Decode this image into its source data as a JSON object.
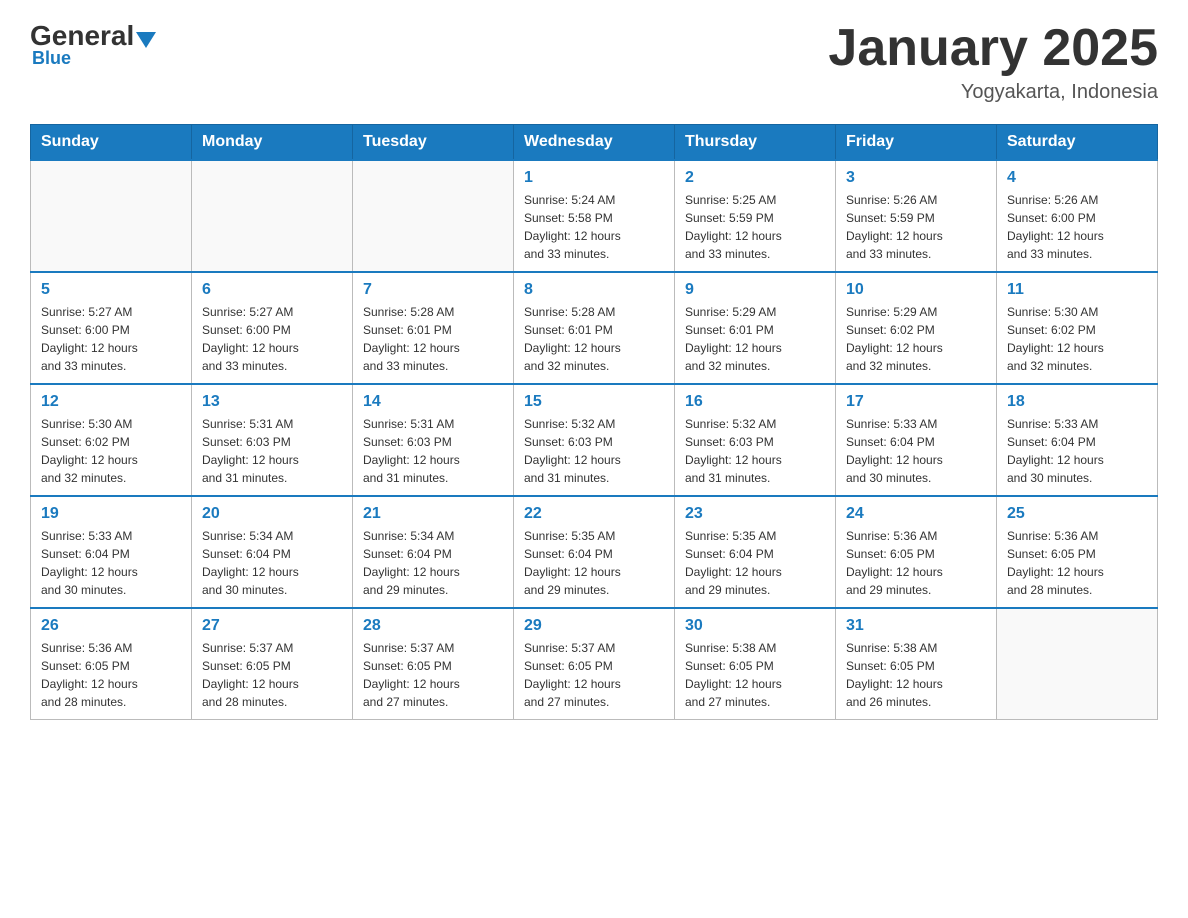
{
  "header": {
    "logo_general": "General",
    "logo_blue": "Blue",
    "calendar_title": "January 2025",
    "calendar_subtitle": "Yogyakarta, Indonesia"
  },
  "weekdays": [
    "Sunday",
    "Monday",
    "Tuesday",
    "Wednesday",
    "Thursday",
    "Friday",
    "Saturday"
  ],
  "weeks": [
    [
      {
        "day": "",
        "info": ""
      },
      {
        "day": "",
        "info": ""
      },
      {
        "day": "",
        "info": ""
      },
      {
        "day": "1",
        "info": "Sunrise: 5:24 AM\nSunset: 5:58 PM\nDaylight: 12 hours\nand 33 minutes."
      },
      {
        "day": "2",
        "info": "Sunrise: 5:25 AM\nSunset: 5:59 PM\nDaylight: 12 hours\nand 33 minutes."
      },
      {
        "day": "3",
        "info": "Sunrise: 5:26 AM\nSunset: 5:59 PM\nDaylight: 12 hours\nand 33 minutes."
      },
      {
        "day": "4",
        "info": "Sunrise: 5:26 AM\nSunset: 6:00 PM\nDaylight: 12 hours\nand 33 minutes."
      }
    ],
    [
      {
        "day": "5",
        "info": "Sunrise: 5:27 AM\nSunset: 6:00 PM\nDaylight: 12 hours\nand 33 minutes."
      },
      {
        "day": "6",
        "info": "Sunrise: 5:27 AM\nSunset: 6:00 PM\nDaylight: 12 hours\nand 33 minutes."
      },
      {
        "day": "7",
        "info": "Sunrise: 5:28 AM\nSunset: 6:01 PM\nDaylight: 12 hours\nand 33 minutes."
      },
      {
        "day": "8",
        "info": "Sunrise: 5:28 AM\nSunset: 6:01 PM\nDaylight: 12 hours\nand 32 minutes."
      },
      {
        "day": "9",
        "info": "Sunrise: 5:29 AM\nSunset: 6:01 PM\nDaylight: 12 hours\nand 32 minutes."
      },
      {
        "day": "10",
        "info": "Sunrise: 5:29 AM\nSunset: 6:02 PM\nDaylight: 12 hours\nand 32 minutes."
      },
      {
        "day": "11",
        "info": "Sunrise: 5:30 AM\nSunset: 6:02 PM\nDaylight: 12 hours\nand 32 minutes."
      }
    ],
    [
      {
        "day": "12",
        "info": "Sunrise: 5:30 AM\nSunset: 6:02 PM\nDaylight: 12 hours\nand 32 minutes."
      },
      {
        "day": "13",
        "info": "Sunrise: 5:31 AM\nSunset: 6:03 PM\nDaylight: 12 hours\nand 31 minutes."
      },
      {
        "day": "14",
        "info": "Sunrise: 5:31 AM\nSunset: 6:03 PM\nDaylight: 12 hours\nand 31 minutes."
      },
      {
        "day": "15",
        "info": "Sunrise: 5:32 AM\nSunset: 6:03 PM\nDaylight: 12 hours\nand 31 minutes."
      },
      {
        "day": "16",
        "info": "Sunrise: 5:32 AM\nSunset: 6:03 PM\nDaylight: 12 hours\nand 31 minutes."
      },
      {
        "day": "17",
        "info": "Sunrise: 5:33 AM\nSunset: 6:04 PM\nDaylight: 12 hours\nand 30 minutes."
      },
      {
        "day": "18",
        "info": "Sunrise: 5:33 AM\nSunset: 6:04 PM\nDaylight: 12 hours\nand 30 minutes."
      }
    ],
    [
      {
        "day": "19",
        "info": "Sunrise: 5:33 AM\nSunset: 6:04 PM\nDaylight: 12 hours\nand 30 minutes."
      },
      {
        "day": "20",
        "info": "Sunrise: 5:34 AM\nSunset: 6:04 PM\nDaylight: 12 hours\nand 30 minutes."
      },
      {
        "day": "21",
        "info": "Sunrise: 5:34 AM\nSunset: 6:04 PM\nDaylight: 12 hours\nand 29 minutes."
      },
      {
        "day": "22",
        "info": "Sunrise: 5:35 AM\nSunset: 6:04 PM\nDaylight: 12 hours\nand 29 minutes."
      },
      {
        "day": "23",
        "info": "Sunrise: 5:35 AM\nSunset: 6:04 PM\nDaylight: 12 hours\nand 29 minutes."
      },
      {
        "day": "24",
        "info": "Sunrise: 5:36 AM\nSunset: 6:05 PM\nDaylight: 12 hours\nand 29 minutes."
      },
      {
        "day": "25",
        "info": "Sunrise: 5:36 AM\nSunset: 6:05 PM\nDaylight: 12 hours\nand 28 minutes."
      }
    ],
    [
      {
        "day": "26",
        "info": "Sunrise: 5:36 AM\nSunset: 6:05 PM\nDaylight: 12 hours\nand 28 minutes."
      },
      {
        "day": "27",
        "info": "Sunrise: 5:37 AM\nSunset: 6:05 PM\nDaylight: 12 hours\nand 28 minutes."
      },
      {
        "day": "28",
        "info": "Sunrise: 5:37 AM\nSunset: 6:05 PM\nDaylight: 12 hours\nand 27 minutes."
      },
      {
        "day": "29",
        "info": "Sunrise: 5:37 AM\nSunset: 6:05 PM\nDaylight: 12 hours\nand 27 minutes."
      },
      {
        "day": "30",
        "info": "Sunrise: 5:38 AM\nSunset: 6:05 PM\nDaylight: 12 hours\nand 27 minutes."
      },
      {
        "day": "31",
        "info": "Sunrise: 5:38 AM\nSunset: 6:05 PM\nDaylight: 12 hours\nand 26 minutes."
      },
      {
        "day": "",
        "info": ""
      }
    ]
  ]
}
